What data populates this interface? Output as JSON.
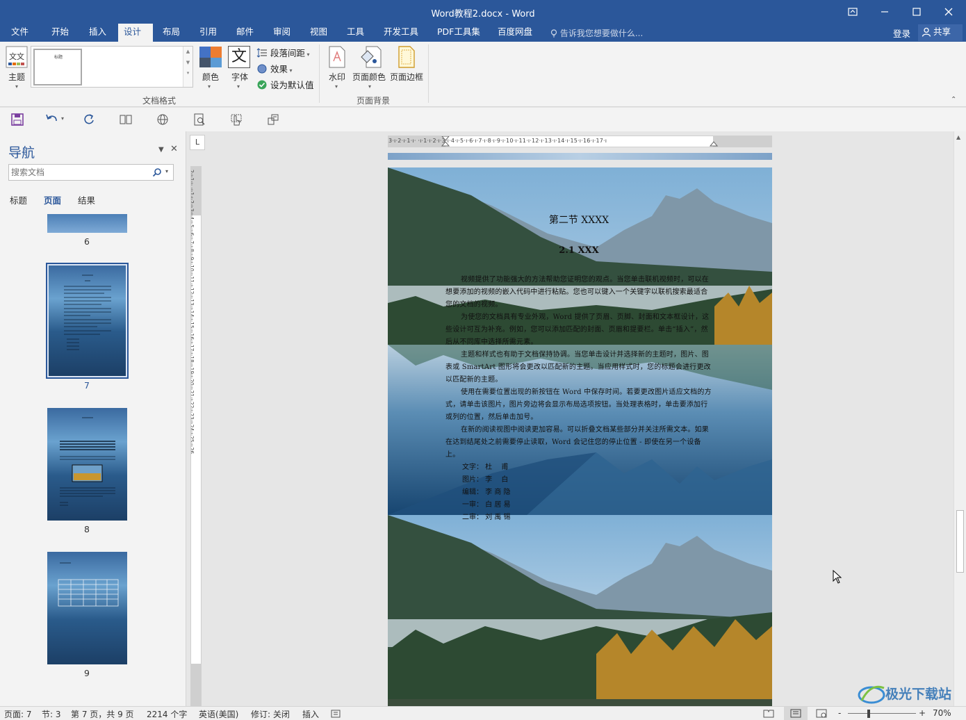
{
  "window": {
    "title": "Word教程2.docx - Word"
  },
  "tabs": [
    {
      "label": "文件"
    },
    {
      "label": "开始"
    },
    {
      "label": "插入"
    },
    {
      "label": "设计"
    },
    {
      "label": "布局"
    },
    {
      "label": "引用"
    },
    {
      "label": "邮件"
    },
    {
      "label": "审阅"
    },
    {
      "label": "视图"
    },
    {
      "label": "工具"
    },
    {
      "label": "开发工具"
    },
    {
      "label": "PDF工具集"
    },
    {
      "label": "百度网盘"
    }
  ],
  "tell_me": "告诉我您想要做什么...",
  "account": {
    "login": "登录",
    "share": "共享"
  },
  "ribbon": {
    "theme_label": "主题",
    "gallery_thumb_text": "标题",
    "colors_label": "颜色",
    "fonts_label": "字体",
    "fonts_glyph": "文",
    "paragraph_spacing": "段落间距",
    "effects": "效果",
    "set_default": "设为默认值",
    "document_format_group": "文档格式",
    "watermark": "水印",
    "page_color": "页面颜色",
    "page_borders": "页面边框",
    "page_background_group": "页面背景"
  },
  "nav": {
    "title": "导航",
    "search_placeholder": "搜索文档",
    "tabs": [
      {
        "label": "标题"
      },
      {
        "label": "页面"
      },
      {
        "label": "结果"
      }
    ],
    "pages": [
      {
        "num": "6"
      },
      {
        "num": "7"
      },
      {
        "num": "8"
      },
      {
        "num": "9"
      }
    ]
  },
  "ruler": {
    "corner": "L",
    "h_text": "3·ı·2·ı·1·ı·  ·ı·1·ı·2·ı·3·ı·4·ı·5·ı·6·ı·7·ı·8·ı·9·ı·10·ı·11·ı·12·ı·13·ı·14·ı·15·ı·16·ı·17·ı",
    "v_text": "2·ı·1·ı· ·ı·1·ı·2·ı·3·ı·4·ı·5·ı·6·ı·7·ı·8·ı·9·ı·10·ı·11·ı·12·ı·13·ı·14·ı·15·ı·16·ı·17·ı·18·ı·19·ı·20·ı·21·ı·22·ı·23·ı·24·ı·25·ı·26"
  },
  "document": {
    "heading1": "第二节 XXXX",
    "heading2": "2.1 XXX",
    "paragraphs": [
      "视频提供了功能强大的方法帮助您证明您的观点。当您单击联机视频时，可以在想要添加的视频的嵌入代码中进行粘贴。您也可以键入一个关键字以联机搜索最适合您的文档的视频。",
      "为使您的文档具有专业外观，Word 提供了页眉、页脚、封面和文本框设计，这些设计可互为补充。例如，您可以添加匹配的封面、页眉和提要栏。单击“插入”，然后从不同库中选择所需元素。",
      "主题和样式也有助于文档保持协调。当您单击设计并选择新的主题时，图片、图表或 SmartArt 图形将会更改以匹配新的主题。当应用样式时，您的标题会进行更改以匹配新的主题。",
      "使用在需要位置出现的新按钮在 Word 中保存时间。若要更改图片适应文档的方式，请单击该图片，图片旁边将会显示布局选项按钮。当处理表格时，单击要添加行或列的位置，然后单击加号。",
      "在新的阅读视图中阅读更加容易。可以折叠文档某些部分并关注所需文本。如果在达到结尾处之前需要停止读取，Word 会记住您的停止位置 - 即使在另一个设备上。"
    ],
    "credits": [
      "文字： 杜　 甫",
      "图片： 李　 白",
      "编辑： 李 商 隐",
      "一审： 白 居 易",
      "二审： 刘 禹 锡"
    ]
  },
  "status": {
    "page": "页面: 7",
    "section": "节: 3",
    "page_of": "第 7 页，共 9 页",
    "words": "2214 个字",
    "language": "英语(美国)",
    "track": "修订: 关闭",
    "insert": "插入",
    "zoom": "70%"
  },
  "watermark_text": "极光下载站",
  "colors": {
    "brand": "#2b579a",
    "ribbon_bg": "#f3f3f3"
  }
}
